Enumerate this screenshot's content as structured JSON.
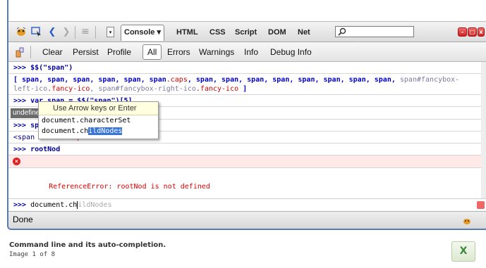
{
  "toolbar": {
    "tabs": [
      "Console",
      "HTML",
      "CSS",
      "Script",
      "DOM",
      "Net"
    ],
    "active_tab": "Console",
    "dropdown_arrow": "▾",
    "icons": [
      "firebug-icon",
      "inspect-icon",
      "back-icon",
      "forward-icon",
      "list-icon",
      "dropdown-icon",
      "search-icon",
      "minimize-icon",
      "detach-icon",
      "close-icon"
    ]
  },
  "filter_bar": {
    "buttons": [
      "Clear",
      "Persist",
      "Profile",
      "All",
      "Errors",
      "Warnings",
      "Info",
      "Debug Info"
    ],
    "active": "All"
  },
  "console": {
    "line1": ">>> $$(\"span\")",
    "line2a_pre": "[ span, span, span, span, span, span",
    "line2a_cls": ".caps",
    "line2a_post": ", span, span, span, span, span, span, span, span, ",
    "line2a_end": "span#fancybox-",
    "line2b_pre": "left-ico",
    "line2b_cls": ".fancy-ico",
    "line2b_mid": ", span#fancybox-right-ico",
    "line2b_cls2": ".fancy-ico",
    "line2b_end": " ]",
    "line3": ">>> var span = $$(\"span\")[5]",
    "line4": "undefined",
    "line5": ">>> span",
    "line6_pre": "<span class=",
    "line6_val": "\"caps\"",
    "line6_post": ">",
    "line7": ">>> rootNod",
    "error_text": "ReferenceError: rootNod is not defined"
  },
  "autocomplete": {
    "hint": "Use Arrow keys or Enter",
    "option1_prefix": "document.ch",
    "option1_rest": "aracterSet",
    "option2_prefix": "document.ch",
    "option2_rest": "ildNodes"
  },
  "command_line": {
    "prompt": ">>> ",
    "typed": "document.ch",
    "completion": "ildNodes"
  },
  "status": "Done",
  "caption": "Command line and its auto-completion.",
  "image_count": "Image 1 of 8",
  "close_label": "X"
}
